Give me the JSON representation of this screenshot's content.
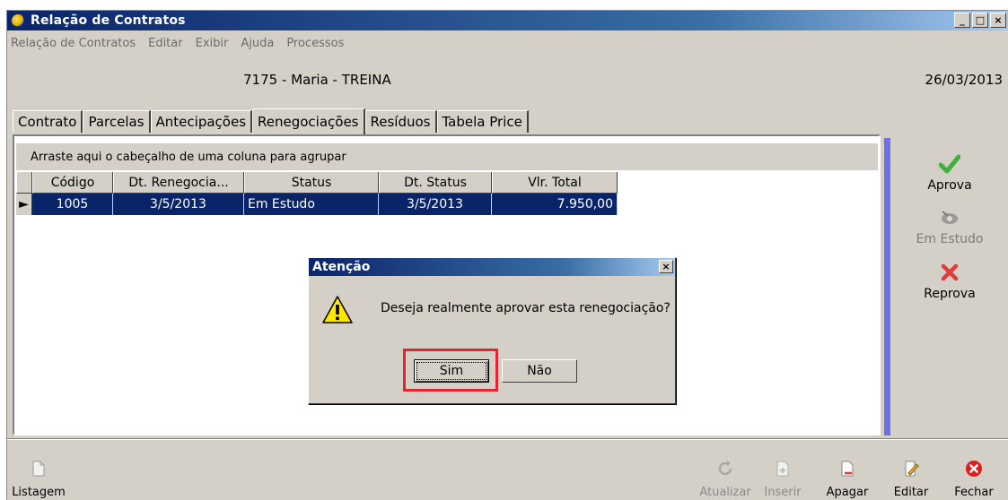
{
  "window": {
    "title": "Relação de Contratos",
    "controls": {
      "minimize": "_",
      "maximize": "□",
      "close": "×"
    }
  },
  "menu": [
    "Relação de Contratos",
    "Editar",
    "Exibir",
    "Ajuda",
    "Processos"
  ],
  "header": {
    "client": "7175 - Maria - TREINA",
    "date": "26/03/2013"
  },
  "tabs": [
    {
      "label": "Contrato"
    },
    {
      "label": "Parcelas"
    },
    {
      "label": "Antecipações"
    },
    {
      "label": "Renegociações",
      "active": true
    },
    {
      "label": "Resíduos"
    },
    {
      "label": "Tabela Price"
    }
  ],
  "grid": {
    "group_hint": "Arraste aqui o cabeçalho de uma coluna para agrupar",
    "columns": [
      "Código",
      "Dt. Renegocia...",
      "Status",
      "Dt. Status",
      "Vlr. Total"
    ],
    "rows": [
      {
        "indicator": "►",
        "codigo": "1005",
        "dt_renegociacao": "3/5/2013",
        "status": "Em Estudo",
        "dt_status": "3/5/2013",
        "vlr_total": "7.950,00"
      }
    ]
  },
  "actions": {
    "aprova": "Aprova",
    "em_estudo": "Em Estudo",
    "reprova": "Reprova"
  },
  "toolbar": {
    "listagem": "Listagem",
    "atualizar": "Atualizar",
    "inserir": "Inserir",
    "apagar": "Apagar",
    "editar": "Editar",
    "fechar": "Fechar"
  },
  "dialog": {
    "title": "Atenção",
    "close": "×",
    "message": "Deseja realmente aprovar esta renegociação?",
    "yes": "Sim",
    "no": "Não"
  },
  "colors": {
    "titlebar": "#0a246a",
    "selection": "#0a246a",
    "side_strip": "#6f6fe8",
    "highlight": "#e4262c",
    "approve_green": "#3cb43c",
    "reject_red": "#e03c3c"
  }
}
